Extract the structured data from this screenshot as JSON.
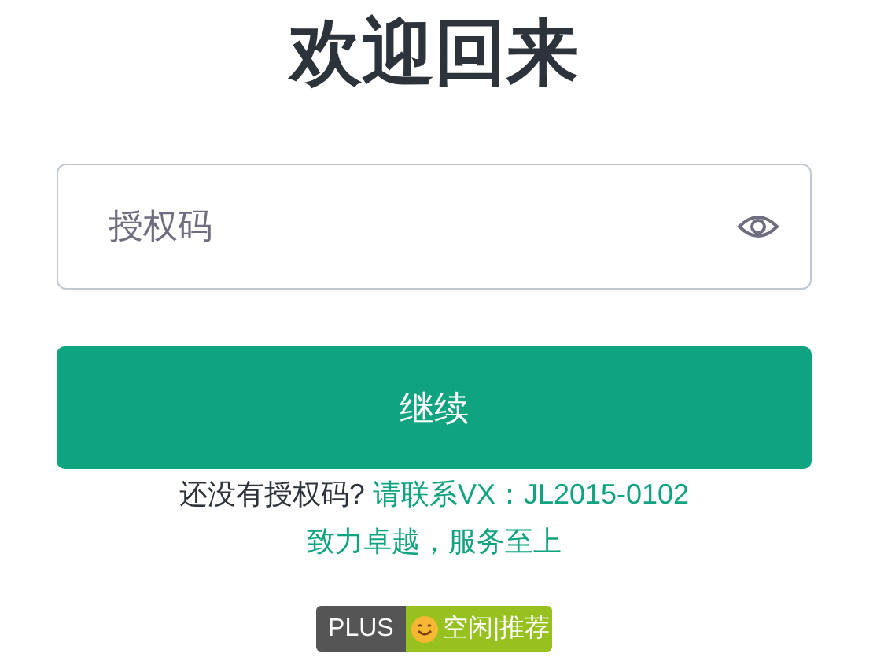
{
  "title": "欢迎回来",
  "auth_field": {
    "placeholder": "授权码",
    "password_hidden": true
  },
  "continue_button": "继续",
  "prompt": {
    "text": "还没有授权码?",
    "link": "请联系VX：JL2015-0102"
  },
  "slogan": "致力卓越，服务至上",
  "badge": {
    "label": "PLUS",
    "status": "空闲|推荐"
  }
}
